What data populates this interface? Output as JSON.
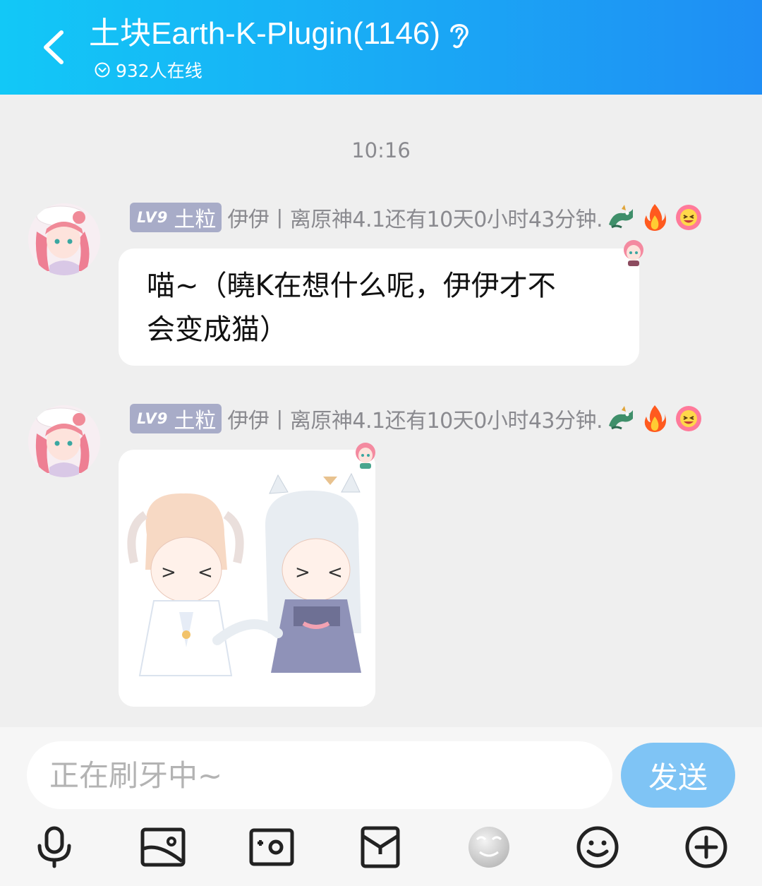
{
  "header": {
    "title": "土块Earth-K-Plugin(1146)",
    "online": "932人在线",
    "colors": {
      "gradient_start": "#12c8f7",
      "gradient_end": "#1f8ef4"
    }
  },
  "chat": {
    "timestamp": "10:16",
    "messages": [
      {
        "level": "LV9",
        "rank": "土粒",
        "sender": "伊伊丨离原神4.1还有10天0小时43分钟.",
        "type": "text",
        "text_line1": "喵~（曉K在想什么呢，伊伊才不",
        "text_line2": "会变成猫）"
      },
      {
        "level": "LV9",
        "rank": "土粒",
        "sender": "伊伊丨离原神4.1还有10天0小时43分钟.",
        "type": "image"
      }
    ],
    "badge_icons": [
      "dragon-icon",
      "fire-icon",
      "grin-flower-icon"
    ]
  },
  "input": {
    "placeholder": "正在刷牙中~",
    "send_label": "发送",
    "send_color": "#7fc4f5"
  },
  "toolbar": [
    "microphone-icon",
    "picture-icon",
    "camera-icon",
    "red-packet-icon",
    "sticker-icon",
    "emoji-icon",
    "plus-icon"
  ]
}
